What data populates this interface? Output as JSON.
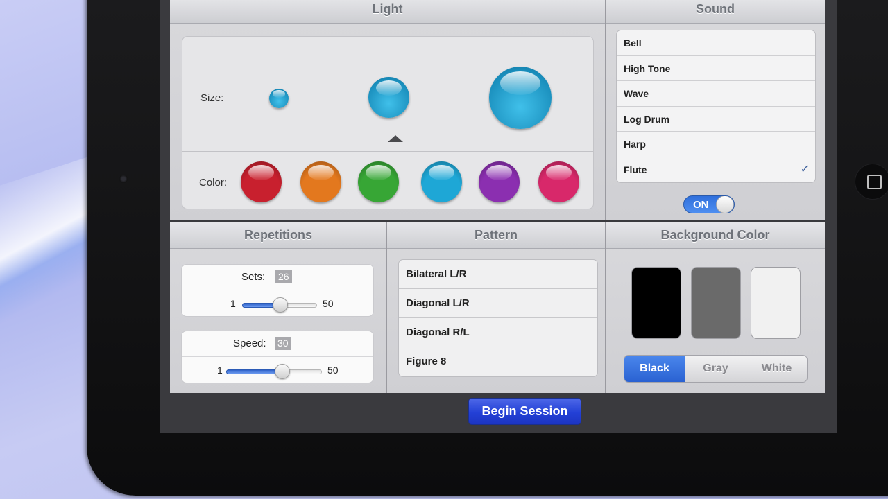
{
  "light": {
    "title": "Light",
    "size_label": "Size:",
    "color_label": "Color:",
    "selected_size": "medium",
    "colors": [
      "#c8202e",
      "#e3781e",
      "#37a635",
      "#1ea7d6",
      "#8b2fb0",
      "#d8286a"
    ]
  },
  "sound": {
    "title": "Sound",
    "items": [
      {
        "label": "Bell"
      },
      {
        "label": "High Tone"
      },
      {
        "label": "Wave"
      },
      {
        "label": "Log Drum"
      },
      {
        "label": "Harp"
      },
      {
        "label": "Flute",
        "selected": true
      }
    ],
    "check": "✓",
    "toggle_label": "ON",
    "toggle_on": true
  },
  "repetitions": {
    "title": "Repetitions",
    "sets_label": "Sets:",
    "sets_value": "26",
    "sets_min": "1",
    "sets_max": "50",
    "sets_fraction": 0.51,
    "speed_label": "Speed:",
    "speed_value": "30",
    "speed_min": "1",
    "speed_max": "50",
    "speed_fraction": 0.59
  },
  "pattern": {
    "title": "Pattern",
    "items": [
      "Bilateral L/R",
      "Diagonal L/R",
      "Diagonal R/L",
      "Figure 8"
    ]
  },
  "background": {
    "title": "Background Color",
    "swatches": [
      "#000000",
      "#6a6a6a",
      "#f1f1f1"
    ],
    "options": [
      "Black",
      "Gray",
      "White"
    ],
    "selected": "Black"
  },
  "begin_label": "Begin Session"
}
